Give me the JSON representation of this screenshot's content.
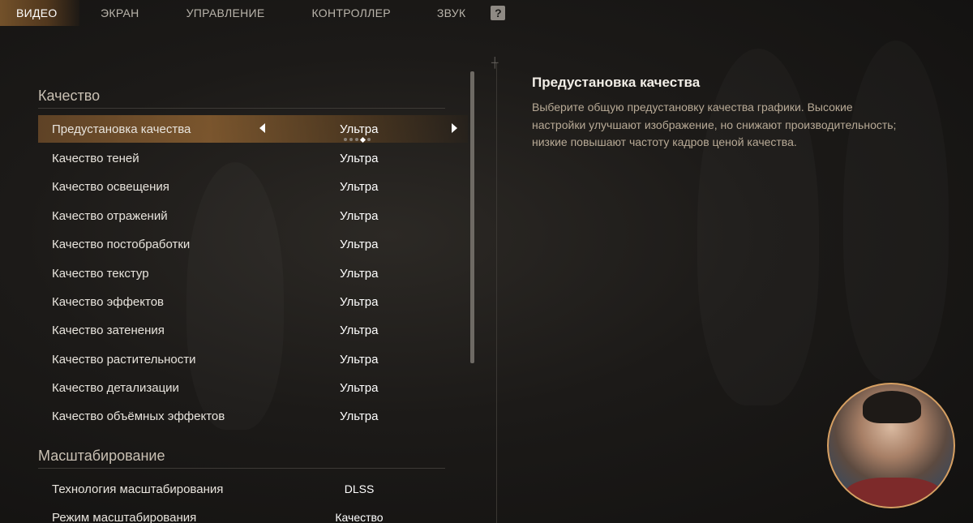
{
  "nav": {
    "tabs": [
      "ВИДЕО",
      "ЭКРАН",
      "УПРАВЛЕНИЕ",
      "КОНТРОЛЛЕР",
      "ЗВУК"
    ],
    "active_index": 0,
    "help_label": "?"
  },
  "quality_section": {
    "title": "Качество",
    "rows": [
      {
        "label": "Предустановка качества",
        "value": "Ультра"
      },
      {
        "label": "Качество теней",
        "value": "Ультра"
      },
      {
        "label": "Качество освещения",
        "value": "Ультра"
      },
      {
        "label": "Качество отражений",
        "value": "Ультра"
      },
      {
        "label": "Качество постобработки",
        "value": "Ультра"
      },
      {
        "label": "Качество текстур",
        "value": "Ультра"
      },
      {
        "label": "Качество эффектов",
        "value": "Ультра"
      },
      {
        "label": "Качество затенения",
        "value": "Ультра"
      },
      {
        "label": "Качество растительности",
        "value": "Ультра"
      },
      {
        "label": "Качество детализации",
        "value": "Ультра"
      },
      {
        "label": "Качество объёмных эффектов",
        "value": "Ультра"
      }
    ],
    "selected_index": 0,
    "preset_option_count": 5,
    "preset_option_selected": 3
  },
  "scaling_section": {
    "title": "Масштабирование",
    "rows": [
      {
        "label": "Технология масштабирования",
        "value": "DLSS"
      },
      {
        "label": "Режим масштабирования",
        "value": "Качество"
      }
    ]
  },
  "description": {
    "title": "Предустановка качества",
    "text": "Выберите общую предустановку качества графики. Высокие настройки улучшают изображение, но снижают производительность; низкие повышают частоту кадров ценой качества."
  },
  "colors": {
    "accent": "#c8873f",
    "avatar_border": "#d7a062",
    "description_text": "#b8aa96"
  }
}
